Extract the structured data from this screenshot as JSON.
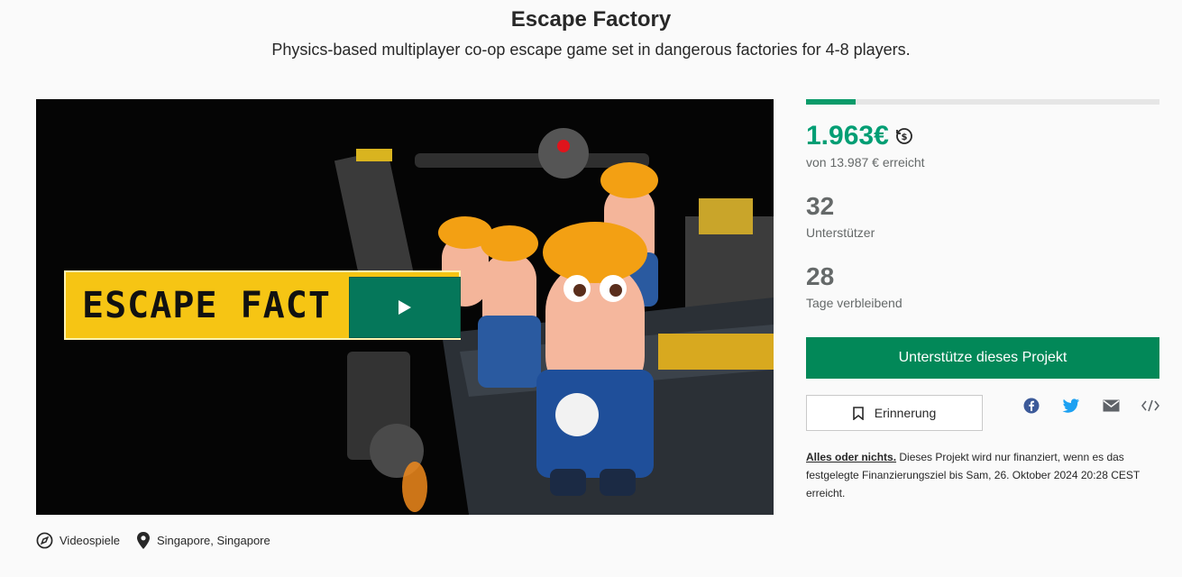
{
  "project": {
    "title": "Escape Factory",
    "subtitle": "Physics-based multiplayer co-op escape game set in dangerous factories for 4-8 players.",
    "video_logo_text": "ESCAPE FACT"
  },
  "meta": {
    "category": "Videospiele",
    "location": "Singapore, Singapore"
  },
  "funding": {
    "progress_fraction": 0.14,
    "pledged": "1.963€",
    "goal_text": "von 13.987 € erreicht",
    "backers_count": "32",
    "backers_label": "Unterstützer",
    "days_count": "28",
    "days_label": "Tage verbleibend"
  },
  "actions": {
    "back_label": "Unterstütze dieses Projekt",
    "remind_label": "Erinnerung"
  },
  "share_icons": [
    "facebook-icon",
    "twitter-icon",
    "mail-icon",
    "embed-icon"
  ],
  "notice": {
    "lead": "Alles oder nichts.",
    "body": " Dieses Projekt wird nur finanziert, wenn es das festgelegte Finanzierungsziel bis Sam, 26. Oktober 2024 20:28 CEST erreicht."
  },
  "colors": {
    "accent": "#009e74",
    "button": "#028858",
    "logo_yellow": "#f6c514"
  }
}
